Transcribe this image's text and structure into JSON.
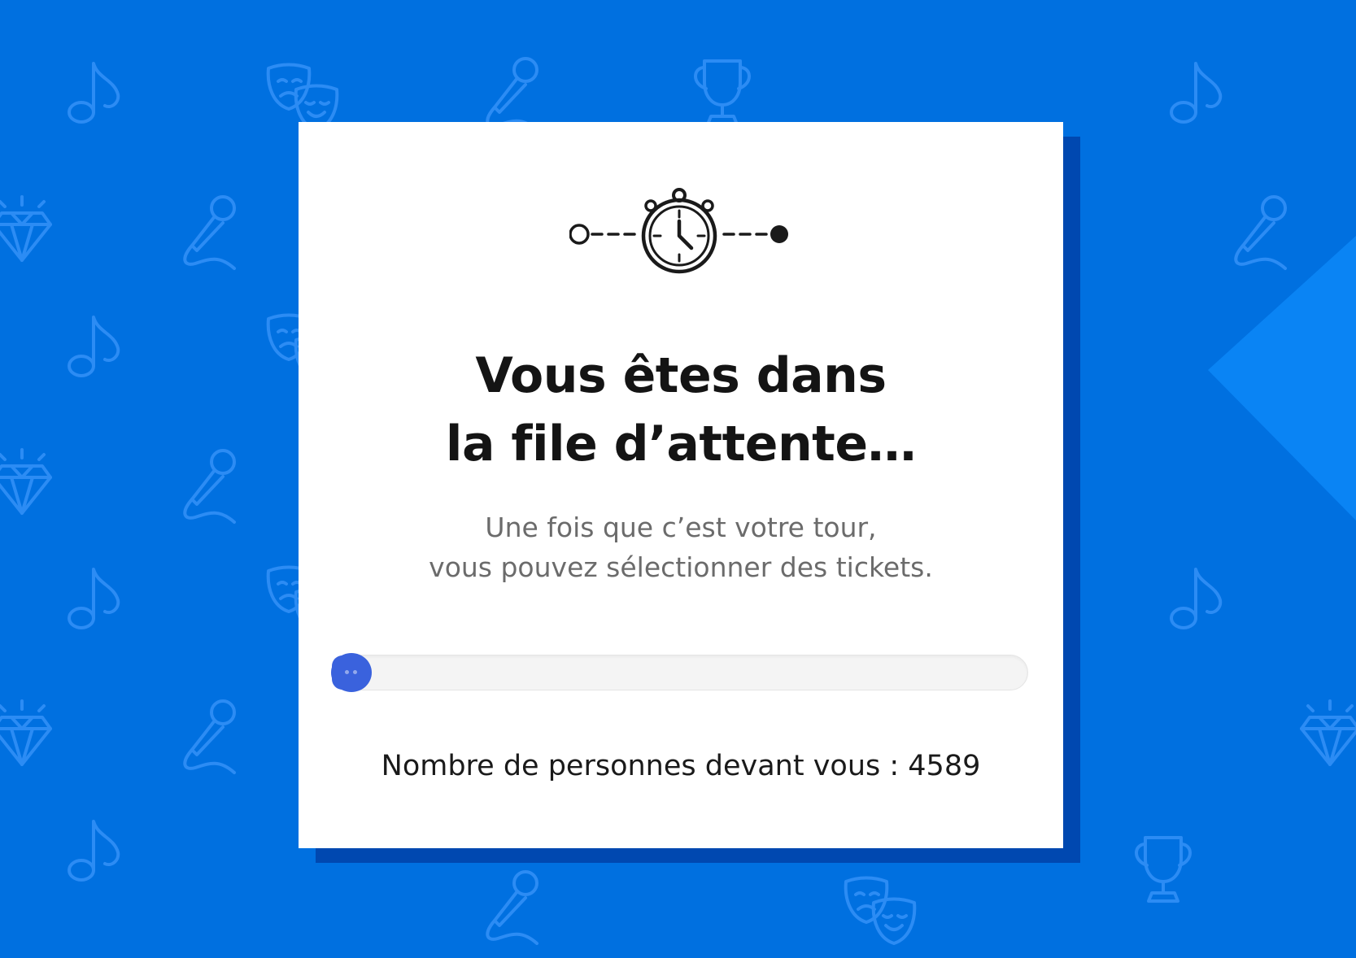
{
  "colors": {
    "background": "#0070e0",
    "pattern_icon": "#2c8cf4",
    "shadow": "#0048b0",
    "card": "#ffffff",
    "progress_fill": "#3a62dd",
    "progress_track": "#f4f4f4",
    "title_text": "#141414",
    "subtitle_text": "#6b6b6b",
    "triangle": "#0a84f4"
  },
  "background_icons": [
    "music-note-icon",
    "theater-masks-icon",
    "microphone-icon",
    "trophy-icon",
    "diamond-icon"
  ],
  "queue": {
    "icon": "stopwatch-icon",
    "title_line1": "Vous êtes dans",
    "title_line2": "la file d’attente…",
    "subtitle_line1": "Une fois que c’est votre tour,",
    "subtitle_line2": "vous pouvez sélectionner des tickets.",
    "progress_fraction": 0.03,
    "people_ahead_label": "Nombre de personnes devant vous : ",
    "people_ahead_count": "4589"
  }
}
